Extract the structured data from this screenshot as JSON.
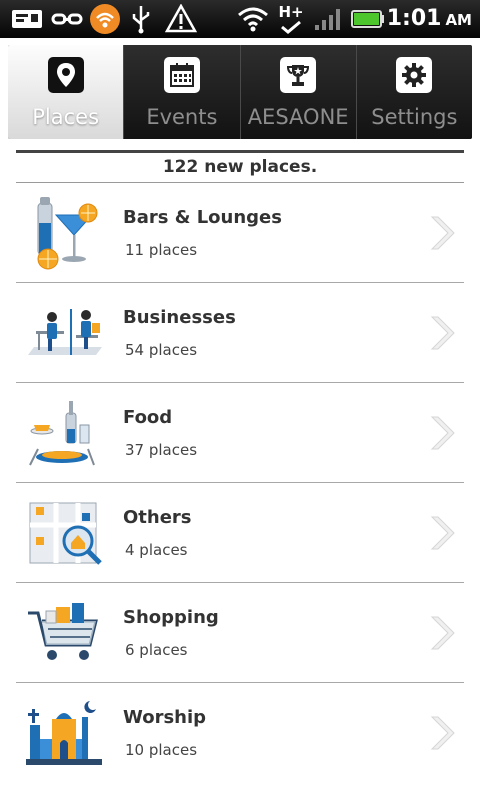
{
  "status_bar": {
    "time": "1:01",
    "ampm": "AM",
    "icons": [
      "sms-icon",
      "usb-connection-icon",
      "wifi-hotspot-icon",
      "usb-icon",
      "warning-icon",
      "wifi-signal-icon",
      "hspa-data-icon",
      "cell-signal-icon",
      "battery-icon"
    ],
    "network_type": "H+",
    "hotspot_color": "#f08a24",
    "battery_color": "#4cc62c"
  },
  "tabs": [
    {
      "label": "Places",
      "icon": "map-pin-icon",
      "active": true
    },
    {
      "label": "Events",
      "icon": "calendar-icon",
      "active": false
    },
    {
      "label": "AESAONE",
      "icon": "trophy-icon",
      "active": false
    },
    {
      "label": "Settings",
      "icon": "gear-icon",
      "active": false
    }
  ],
  "summary": "122 new places.",
  "categories": [
    {
      "title": "Bars & Lounges",
      "count": "11 places",
      "icon": "cocktail-icon"
    },
    {
      "title": "Businesses",
      "count": "54 places",
      "icon": "office-workers-icon"
    },
    {
      "title": "Food",
      "count": "37 places",
      "icon": "dining-icon"
    },
    {
      "title": "Others",
      "count": "4 places",
      "icon": "map-search-icon"
    },
    {
      "title": "Shopping",
      "count": "6 places",
      "icon": "shopping-cart-icon"
    },
    {
      "title": "Worship",
      "count": "10 places",
      "icon": "mosque-church-icon"
    }
  ],
  "colors": {
    "accent_blue": "#1f6fb5",
    "accent_orange": "#f5a623",
    "text_dark": "#333333"
  }
}
